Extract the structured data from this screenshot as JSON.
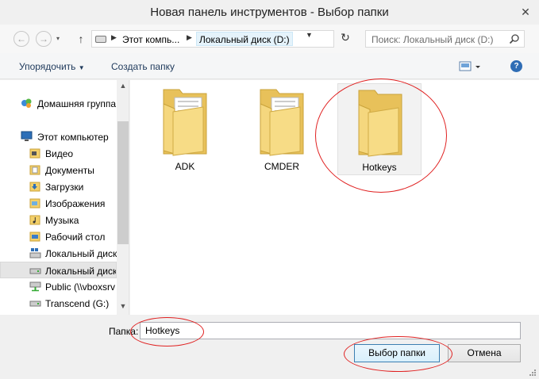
{
  "window": {
    "title": "Новая панель инструментов - Выбор папки",
    "close_icon": "close-icon"
  },
  "navigation": {
    "back_icon": "back-arrow-icon",
    "forward_icon": "forward-arrow-icon",
    "up_icon": "up-arrow-icon",
    "address_parts": [
      "Этот компь...",
      "Локальный диск (D:)"
    ],
    "refresh_icon": "refresh-icon",
    "search_placeholder": "Поиск: Локальный диск (D:)"
  },
  "toolbar": {
    "organize_label": "Упорядочить",
    "new_folder_label": "Создать папку"
  },
  "sidebar": {
    "items": [
      {
        "label": "Домашняя группа",
        "icon": "homegroup-icon"
      },
      {
        "label": "Этот компьютер",
        "icon": "computer-icon"
      },
      {
        "label": "Видео",
        "icon": "video-folder-icon"
      },
      {
        "label": "Документы",
        "icon": "documents-folder-icon"
      },
      {
        "label": "Загрузки",
        "icon": "downloads-folder-icon"
      },
      {
        "label": "Изображения",
        "icon": "pictures-folder-icon"
      },
      {
        "label": "Музыка",
        "icon": "music-folder-icon"
      },
      {
        "label": "Рабочий стол",
        "icon": "desktop-folder-icon"
      },
      {
        "label": "Локальный диск",
        "icon": "system-drive-icon"
      },
      {
        "label": "Локальный диск",
        "icon": "drive-icon"
      },
      {
        "label": "Public (\\\\vboxsrv",
        "icon": "network-drive-icon"
      },
      {
        "label": "Transcend (G:)",
        "icon": "usb-drive-icon"
      }
    ]
  },
  "folders": [
    {
      "name": "ADK"
    },
    {
      "name": "CMDER"
    },
    {
      "name": "Hotkeys"
    }
  ],
  "bottom": {
    "folder_field_label": "Папка:",
    "folder_field_value": "Hotkeys",
    "select_button": "Выбор папки",
    "cancel_button": "Отмена"
  },
  "colors": {
    "annotation": "#e02020",
    "folder": "#f5d77e",
    "selection": "#e5f3fb"
  }
}
